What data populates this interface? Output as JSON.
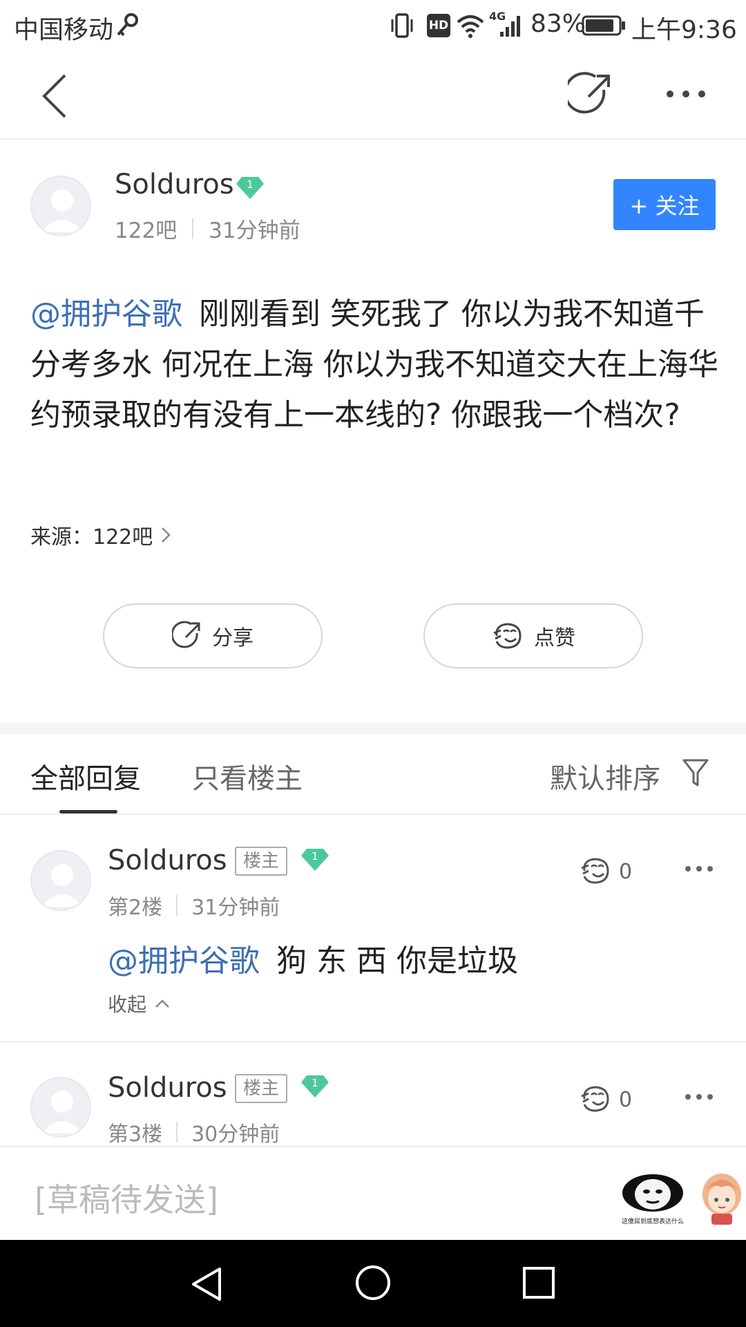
{
  "status_bar": {
    "carrier": "中国移动",
    "battery": "83%",
    "time": "上午9:36",
    "network": "4G",
    "hd_label": "HD"
  },
  "nav": {
    "back_icon": "back-icon",
    "share_icon": "share-icon",
    "more_icon": "more-icon"
  },
  "post": {
    "author": "Solduros",
    "level": "1",
    "forum": "122吧",
    "time": "31分钟前",
    "follow_label": "+ 关注",
    "mention": "@拥护谷歌",
    "text": "刚刚看到 笑死我了 你以为我不知道千分考多水 何况在上海 你以为我不知道交大在上海华约预录取的有没有上一本线的? 你跟我一个档次?",
    "source_label": "来源：",
    "source_value": "122吧",
    "share_label": "分享",
    "like_label": "点赞"
  },
  "tabs": {
    "all_replies": "全部回复",
    "only_op": "只看楼主",
    "sort_label": "默认排序"
  },
  "replies": [
    {
      "author": "Solduros",
      "op_tag": "楼主",
      "level": "1",
      "floor": "第2楼",
      "time": "31分钟前",
      "likes": "0",
      "mention": "@拥护谷歌",
      "text": "狗 东 西 你是垃圾",
      "collapse_label": "收起"
    },
    {
      "author": "Solduros",
      "op_tag": "楼主",
      "level": "1",
      "floor": "第3楼",
      "time": "30分钟前",
      "likes": "0"
    }
  ],
  "input": {
    "draft_placeholder": "[草稿待发送]",
    "sticker_caption": "这傻屌到底想表达什么"
  },
  "colors": {
    "accent": "#3385ff",
    "mention": "#3c6fb4",
    "level_badge": "#4cc99a"
  }
}
